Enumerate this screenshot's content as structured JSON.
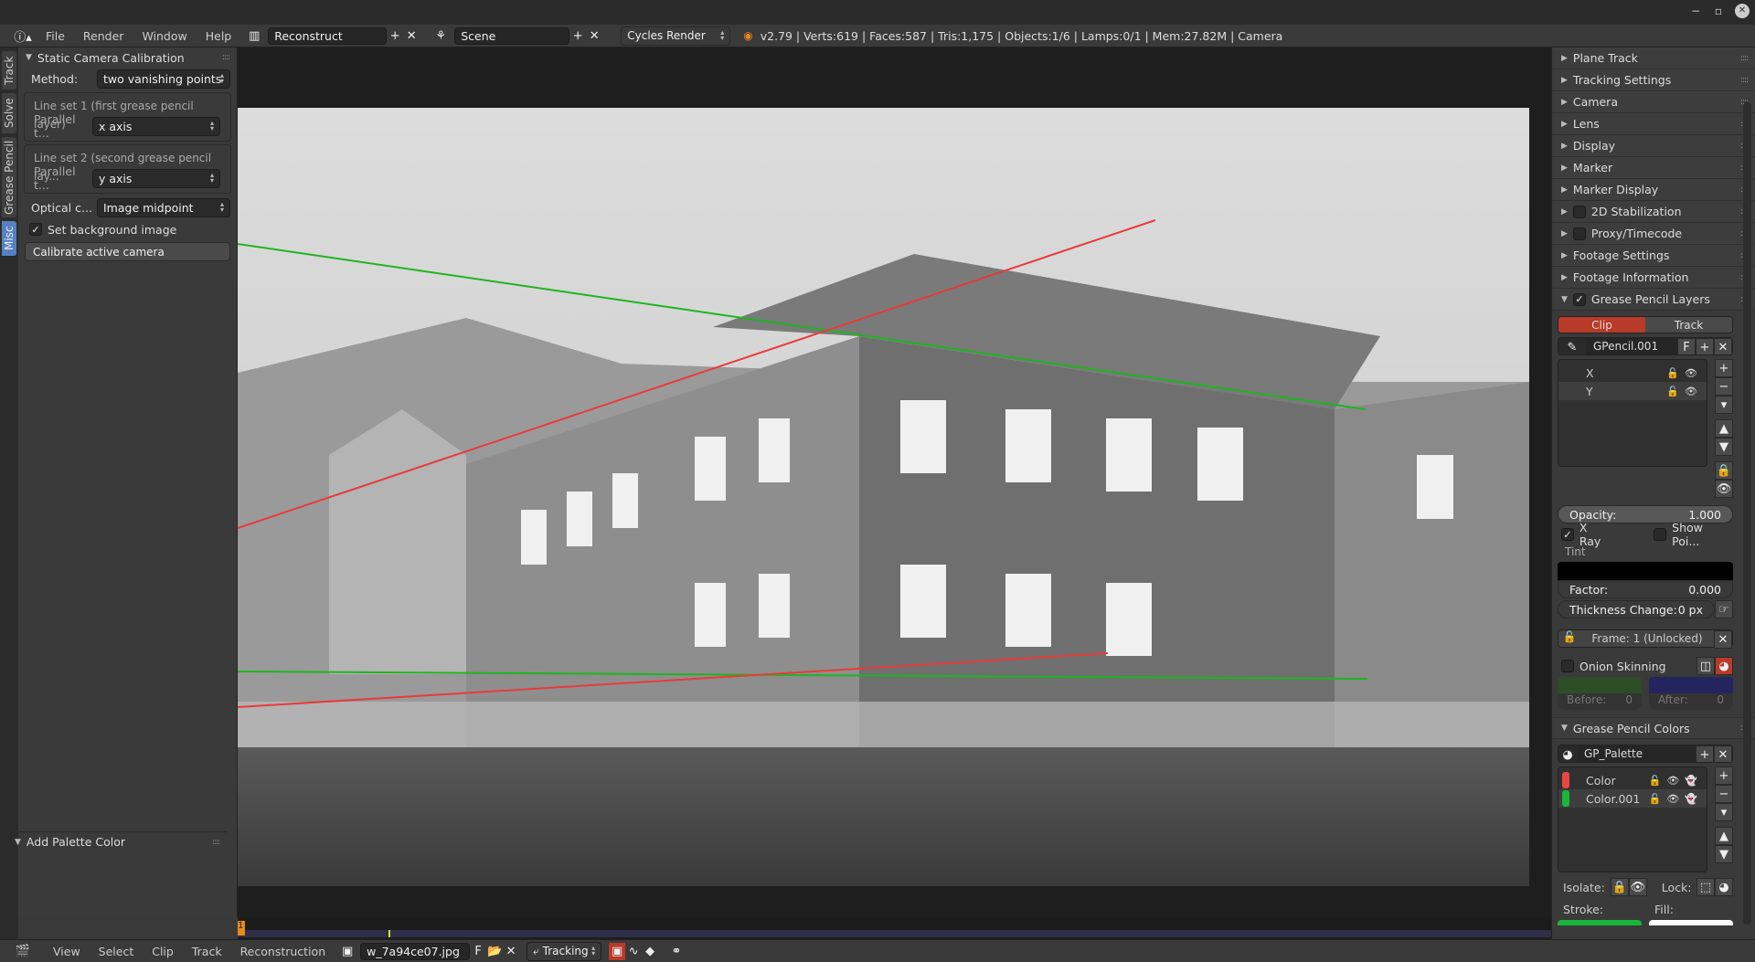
{
  "window": {
    "controls": [
      "−",
      "▫",
      "✕"
    ]
  },
  "topbar": {
    "menus": [
      "File",
      "Render",
      "Window",
      "Help"
    ],
    "screen_layout": "Reconstruct",
    "scene": "Scene",
    "render_engine": "Cycles Render",
    "stats": "v2.79 | Verts:619 | Faces:587 | Tris:1,175 | Objects:1/6 | Lamps:0/1 | Mem:27.82M | Camera"
  },
  "tabs": [
    "Track",
    "Solve",
    "Grease Pencil",
    "Misc"
  ],
  "active_tab": "Misc",
  "left_panel": {
    "title": "Static Camera Calibration",
    "method_label": "Method:",
    "method_value": "two vanishing points",
    "lineset1_label": "Line set 1 (first grease pencil layer)",
    "lineset1_parallel_label": "Parallel t...",
    "lineset1_value": "x axis",
    "lineset2_label": "Line set 2 (second grease pencil lay...",
    "lineset2_parallel_label": "Parallel t...",
    "lineset2_value": "y axis",
    "optical_label": "Optical c...",
    "optical_value": "Image midpoint",
    "set_background_label": "Set background image",
    "set_background_checked": true,
    "calibrate_button": "Calibrate active camera",
    "add_palette_title": "Add Palette Color"
  },
  "viewport": {
    "lines": [
      {
        "layer": "X",
        "color": "#1fb51f",
        "from": [
          0,
          0
        ],
        "to": [
          0,
          0
        ]
      },
      {
        "layer": "Y",
        "color": "#e83a3a"
      }
    ]
  },
  "timeline": {
    "current_frame": "1"
  },
  "bottombar": {
    "menus": [
      "View",
      "Select",
      "Clip",
      "Track",
      "Reconstruction"
    ],
    "clip_name": "w_7a94ce07.jpg",
    "clip_f": "F",
    "mode": "Tracking"
  },
  "right_panel": {
    "collapsed": [
      "Plane Track",
      "Tracking Settings",
      "Camera",
      "Lens",
      "Display",
      "Marker",
      "Marker Display",
      "2D Stabilization",
      "Proxy/Timecode",
      "Footage Settings",
      "Footage Information"
    ],
    "gp_layers_title": "Grease Pencil Layers",
    "source_tabs": [
      "Clip",
      "Track"
    ],
    "active_source": "Clip",
    "gpencil_name": "GPencil.001",
    "gpencil_f": "F",
    "layers": [
      "X",
      "Y"
    ],
    "opacity_label": "Opacity:",
    "opacity_value": "1.000",
    "xray_label": "X Ray",
    "xray_checked": true,
    "show_points_label": "Show Poi...",
    "tint_label": "Tint",
    "factor_label": "Factor:",
    "factor_value": "0.000",
    "thickness_label": "Thickness Change:",
    "thickness_value": "0 px",
    "frame_label": "Frame: 1 (Unlocked)",
    "onion_label": "Onion Skinning",
    "before_label": "Before:",
    "before_value": "0",
    "after_label": "After:",
    "after_value": "0",
    "onion_before_color": "#2d4d26",
    "onion_after_color": "#24245e",
    "gp_colors_title": "Grease Pencil Colors",
    "palette_name": "GP_Palette",
    "colors": [
      {
        "name": "Color",
        "swatch": "#e84545"
      },
      {
        "name": "Color.001",
        "swatch": "#19b63a"
      }
    ],
    "isolate_label": "Isolate:",
    "lock_label": "Lock:",
    "stroke_label": "Stroke:",
    "fill_label": "Fill:",
    "stroke_color": "#19b63a",
    "fill_color": "#ffffff"
  },
  "colors": {
    "accent_red": "#b83a28",
    "active_tab": "#5680c2"
  }
}
